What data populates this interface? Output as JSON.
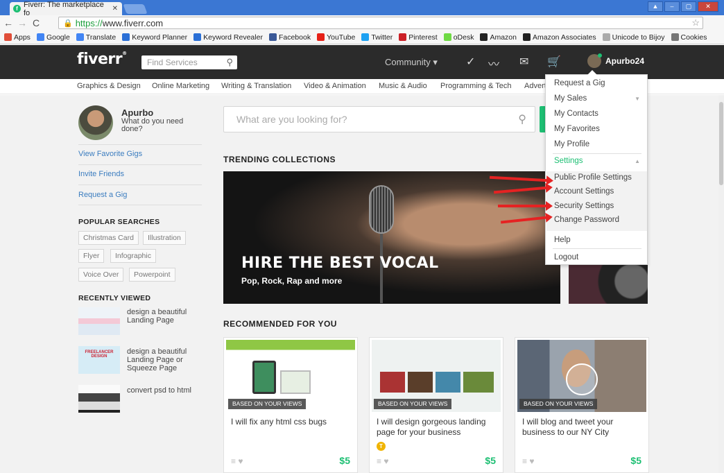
{
  "browser": {
    "tab_title": "Fiverr: The marketplace fo",
    "url_scheme": "https://",
    "url_host": "www.fiverr.com",
    "bookmarks": [
      {
        "label": "Apps",
        "icon": "apps-icon",
        "color": "#e04e39"
      },
      {
        "label": "Google",
        "icon": "google-icon",
        "color": "#4285f4"
      },
      {
        "label": "Translate",
        "icon": "translate-icon",
        "color": "#4285f4"
      },
      {
        "label": "Keyword Planner",
        "icon": "adwords-icon",
        "color": "#2a6fd6"
      },
      {
        "label": "Keyword Revealer",
        "icon": "keyword-revealer-icon",
        "color": "#2a6fd6"
      },
      {
        "label": "Facebook",
        "icon": "facebook-icon",
        "color": "#3b5998"
      },
      {
        "label": "YouTube",
        "icon": "youtube-icon",
        "color": "#e62117"
      },
      {
        "label": "Twitter",
        "icon": "twitter-icon",
        "color": "#1da1f2"
      },
      {
        "label": "Pinterest",
        "icon": "pinterest-icon",
        "color": "#cb2027"
      },
      {
        "label": "oDesk",
        "icon": "odesk-icon",
        "color": "#6fda44"
      },
      {
        "label": "Amazon",
        "icon": "amazon-icon",
        "color": "#222222"
      },
      {
        "label": "Amazon Associates",
        "icon": "amazon-icon",
        "color": "#222222"
      },
      {
        "label": "Unicode to Bijoy",
        "icon": "page-icon",
        "color": "#aaaaaa"
      },
      {
        "label": "Cookies",
        "icon": "gear-icon",
        "color": "#777777"
      }
    ]
  },
  "header": {
    "logo": "fiverr",
    "search_placeholder": "Find Services",
    "community": "Community",
    "username": "Apurbo24"
  },
  "categories": [
    "Graphics & Design",
    "Online Marketing",
    "Writing & Translation",
    "Video & Animation",
    "Music & Audio",
    "Programming & Tech",
    "Advert"
  ],
  "sidebar": {
    "name": "Apurbo",
    "tagline": "What do you need done?",
    "links": [
      "View Favorite Gigs",
      "Invite Friends",
      "Request a Gig"
    ],
    "popular_title": "POPULAR SEARCHES",
    "tags": [
      "Christmas Card",
      "Illustration",
      "Flyer",
      "Infographic",
      "Voice Over",
      "Powerpoint"
    ],
    "recent_title": "RECENTLY VIEWED",
    "recent": [
      {
        "title": "design a beautiful Landing Page"
      },
      {
        "title": "design a beautiful Landing Page or Squeeze Page",
        "thumb_text": "FREELANCER DESIGN"
      },
      {
        "title": "convert psd to html"
      }
    ]
  },
  "main": {
    "search_placeholder": "What are you looking for?",
    "trending_title": "TRENDING COLLECTIONS",
    "hero_title": "HIRE THE BEST VOCAL",
    "hero_sub": "Pop, Rock, Rap and more",
    "recommended_title": "RECOMMENDED FOR YOU",
    "cards": [
      {
        "badge": "BASED ON YOUR VIEWS",
        "title": "I will fix any html css bugs",
        "price": "$5"
      },
      {
        "badge": "BASED ON YOUR VIEWS",
        "title": "I will design gorgeous landing page for your business",
        "price": "$5",
        "level": "T"
      },
      {
        "badge": "BASED ON YOUR VIEWS",
        "title": "I will blog and tweet your business to our NY City",
        "price": "$5"
      }
    ]
  },
  "dropdown": {
    "items": [
      "Request a Gig",
      "My Sales",
      "My Contacts",
      "My Favorites",
      "My Profile"
    ],
    "settings": "Settings",
    "settings_items": [
      "Public Profile Settings",
      "Account Settings",
      "Security Settings",
      "Change Password"
    ],
    "help": "Help",
    "logout": "Logout"
  },
  "colors": {
    "accent": "#1dbf73",
    "header_bg": "#2b2b2b",
    "arrow": "#e52222"
  }
}
